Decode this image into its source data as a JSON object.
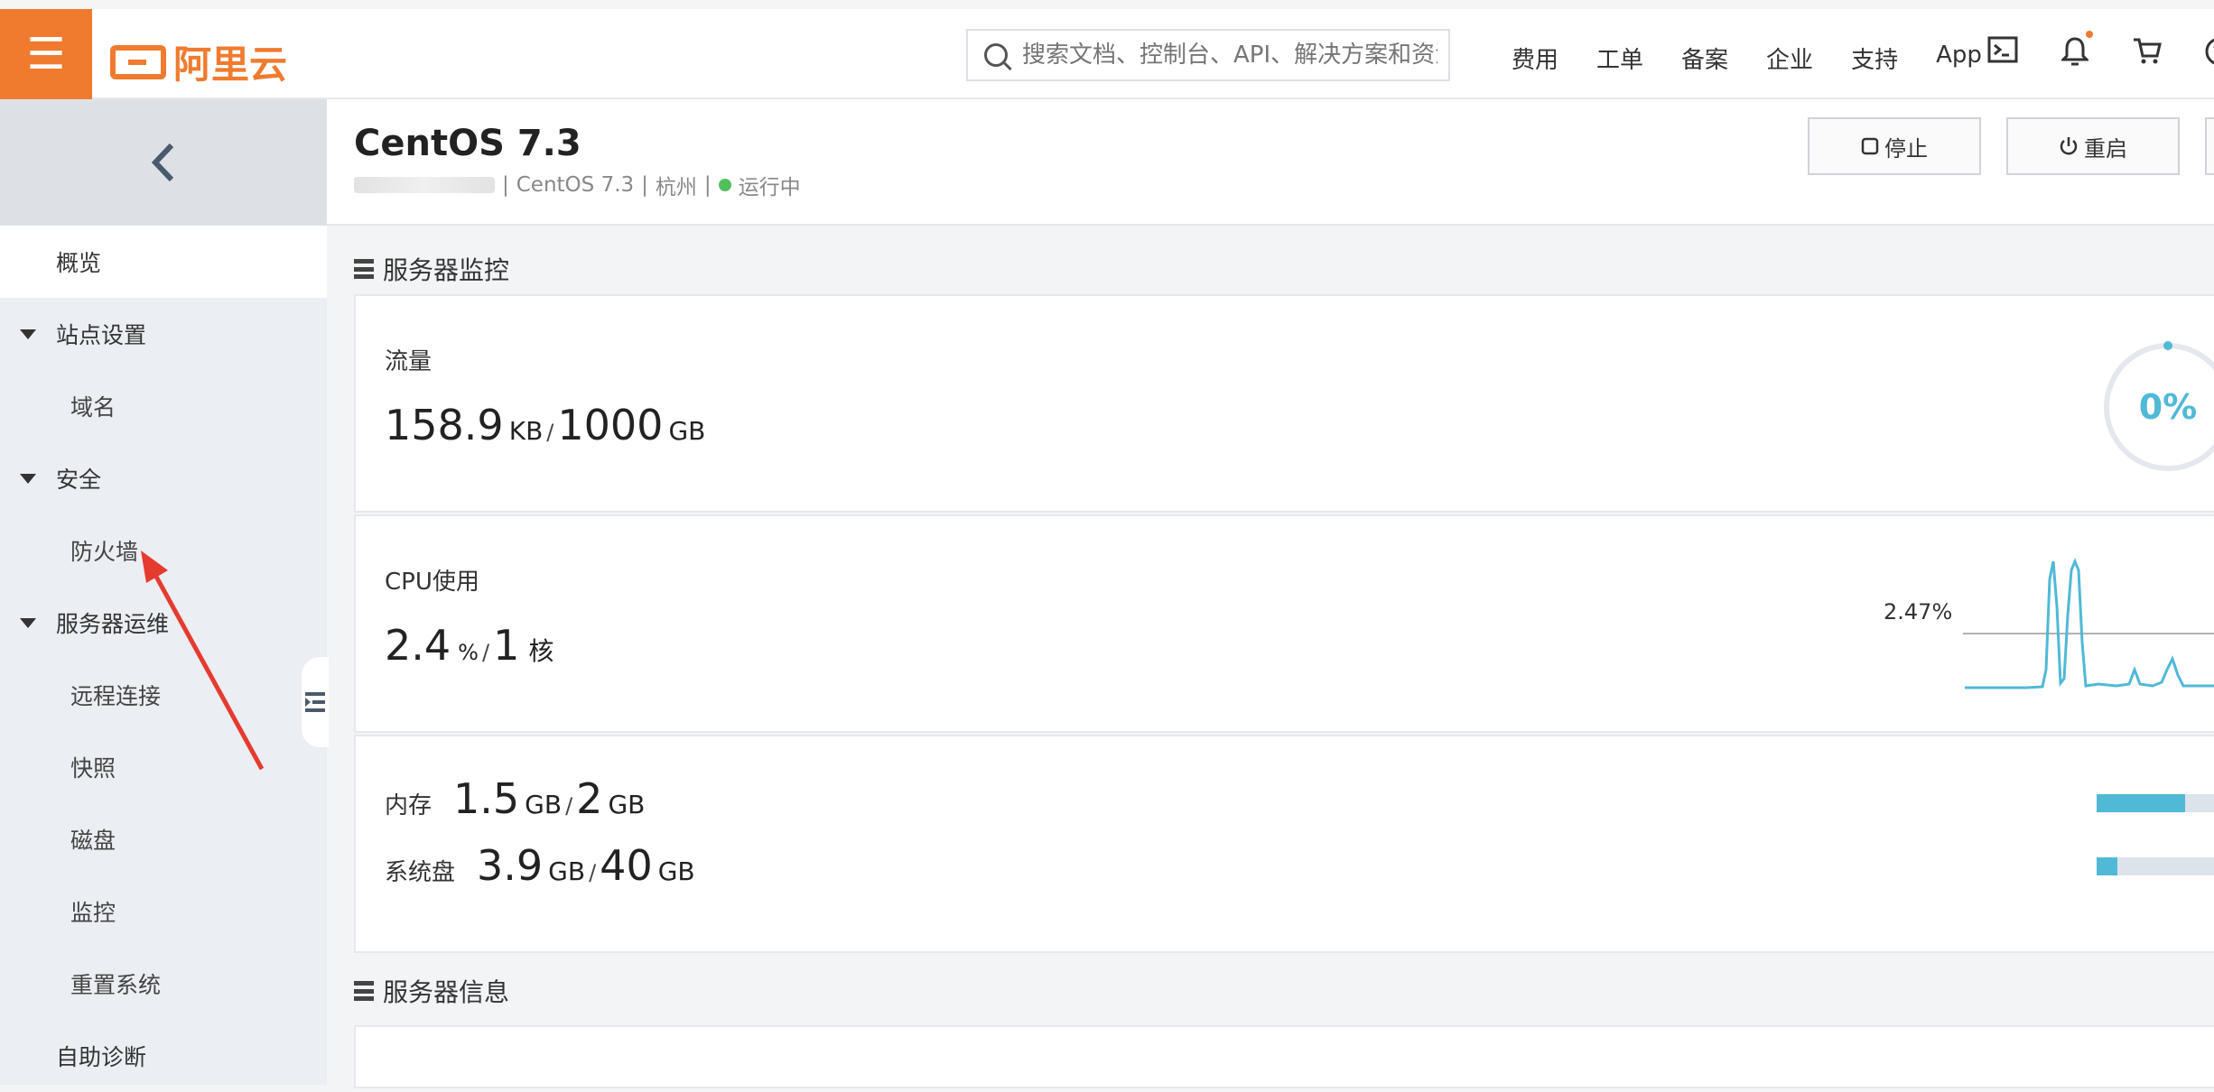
{
  "topbar": {
    "menu_icon": "hamburger-icon",
    "logo_text": "阿里云",
    "search_placeholder": "搜索文档、控制台、API、解决方案和资源",
    "nav": [
      "费用",
      "工单",
      "备案",
      "企业",
      "支持",
      "App"
    ]
  },
  "sidebar": {
    "collapse_icon": "chevron-left-icon",
    "items": [
      {
        "label": "概览",
        "type": "item"
      },
      {
        "label": "站点设置",
        "type": "group"
      },
      {
        "label": "域名",
        "type": "sub"
      },
      {
        "label": "安全",
        "type": "group"
      },
      {
        "label": "防火墙",
        "type": "sub"
      },
      {
        "label": "服务器运维",
        "type": "group"
      },
      {
        "label": "远程连接",
        "type": "sub"
      },
      {
        "label": "快照",
        "type": "sub"
      },
      {
        "label": "磁盘",
        "type": "sub"
      },
      {
        "label": "监控",
        "type": "sub"
      },
      {
        "label": "重置系统",
        "type": "sub"
      },
      {
        "label": "自助诊断",
        "type": "item"
      }
    ]
  },
  "header": {
    "title": "CentOS 7.3",
    "os": "CentOS 7.3",
    "region": "杭州",
    "status": "运行中",
    "status_color": "#52c05a",
    "stop_label": "停止",
    "restart_label": "重启"
  },
  "monitor": {
    "section_title": "服务器监控",
    "traffic": {
      "label": "流量",
      "used": "158.9",
      "used_unit": "KB",
      "total": "1000",
      "total_unit": "GB",
      "percent_label": "0%"
    },
    "cpu": {
      "label": "CPU使用",
      "used": "2.4",
      "used_unit": "%",
      "total": "1",
      "total_unit": "核",
      "chart_value_label": "2.47%"
    },
    "memory": {
      "label": "内存",
      "used": "1.5",
      "used_unit": "GB",
      "total": "2",
      "total_unit": "GB",
      "fraction": 0.75
    },
    "disk": {
      "label": "系统盘",
      "used": "3.9",
      "used_unit": "GB",
      "total": "40",
      "total_unit": "GB",
      "fraction": 0.0975
    }
  },
  "info": {
    "section_title": "服务器信息"
  },
  "accent_color": "#f07b2f",
  "chart_color": "#4fb9d6"
}
